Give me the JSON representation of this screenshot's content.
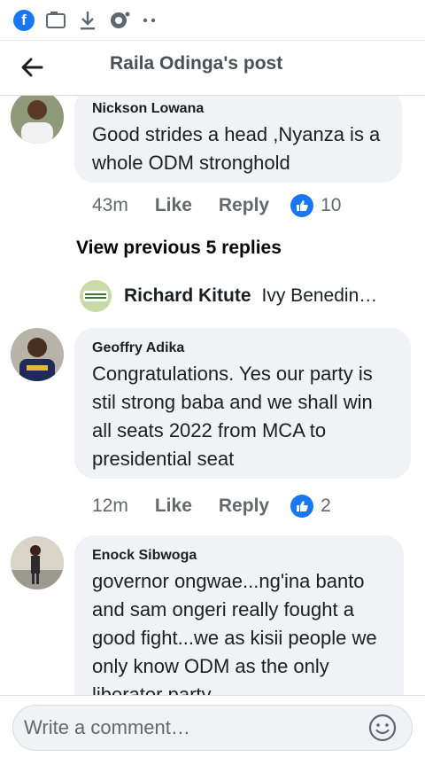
{
  "status_icons": [
    "facebook-icon",
    "screenshot-icon",
    "download-icon",
    "chat-icon",
    "more-dots-icon"
  ],
  "header": {
    "back_icon": "back-arrow-icon",
    "title": "Raila Odinga's post"
  },
  "comments": [
    {
      "name": "Nickson Lowana",
      "text": "Good strides a head ,Nyanza is a whole ODM stronghold",
      "time": "43m",
      "like_label": "Like",
      "reply_label": "Reply",
      "reactions": "10"
    },
    {
      "name": "Geoffry Adika",
      "text": "Congratulations. Yes our party is stil strong  baba and we shall win all seats  2022 from MCA to presidential seat",
      "time": "12m",
      "like_label": "Like",
      "reply_label": "Reply",
      "reactions": "2"
    },
    {
      "name": "Enock Sibwoga",
      "text": "governor ongwae...ng'ina banto and sam ongeri really fought a good fight...we as kisii people we only know ODM as the only liberator party..."
    }
  ],
  "view_previous": "View previous 5 replies",
  "reply_preview": {
    "name": "Richard Kitute",
    "text": "Ivy Benedin…"
  },
  "composer": {
    "placeholder": "Write a comment…",
    "emoji_icon": "smiley-icon"
  },
  "colors": {
    "accent": "#1877f2",
    "bubble": "#f0f2f5",
    "muted": "#65676b"
  }
}
